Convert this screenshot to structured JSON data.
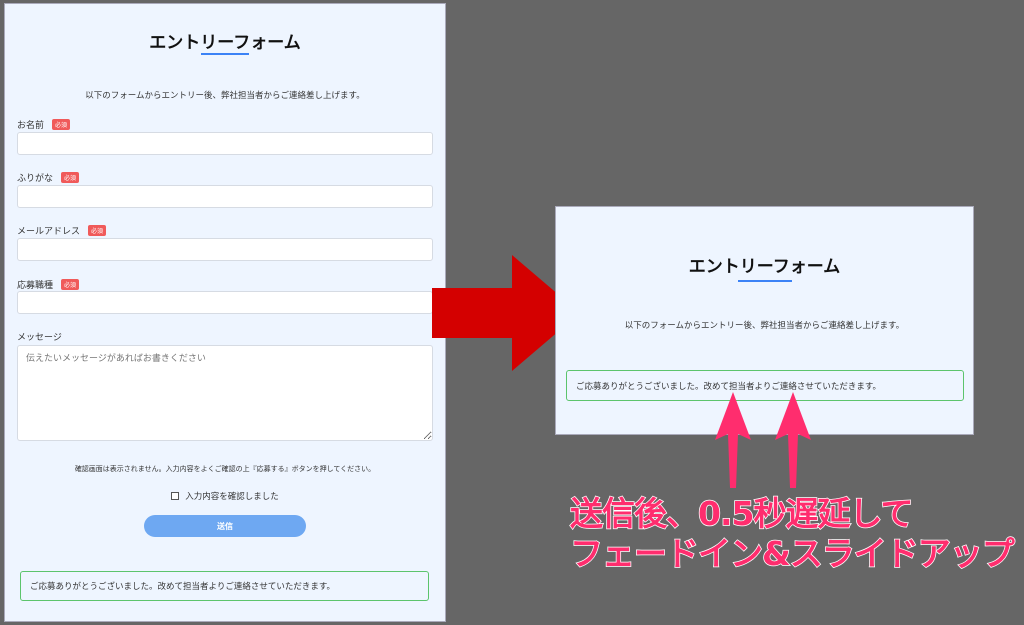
{
  "form": {
    "title": "エントリーフォーム",
    "description": "以下のフォームからエントリー後、弊社担当者からご連絡差し上げます。",
    "required_badge": "必須",
    "fields": [
      {
        "label": "お名前",
        "required": true,
        "value": ""
      },
      {
        "label": "ふりがな",
        "required": true,
        "value": ""
      },
      {
        "label": "メールアドレス",
        "required": true,
        "value": ""
      },
      {
        "label": "応募職種",
        "required": true,
        "value": ""
      }
    ],
    "message": {
      "label": "メッセージ",
      "placeholder": "伝えたいメッセージがあればお書きください"
    },
    "note": "確認画面は表示されません。入力内容をよくご確認の上『応募する』ボタンを押してください。",
    "confirm_checkbox": {
      "label": "入力内容を確認しました",
      "checked": false
    },
    "submit_label": "送信",
    "success_message": "ご応募ありがとうございました。改めて担当者よりご連絡させていただきます。"
  },
  "annotation": {
    "line1": "送信後、0.5秒遅延して",
    "line2": "フェードイン&スライドアップ"
  },
  "colors": {
    "accent": "#3b82f6",
    "required": "#f05a5a",
    "success_border": "#5cc46c",
    "arrow_red": "#d40000",
    "arrow_pink": "#ff2d6e"
  }
}
